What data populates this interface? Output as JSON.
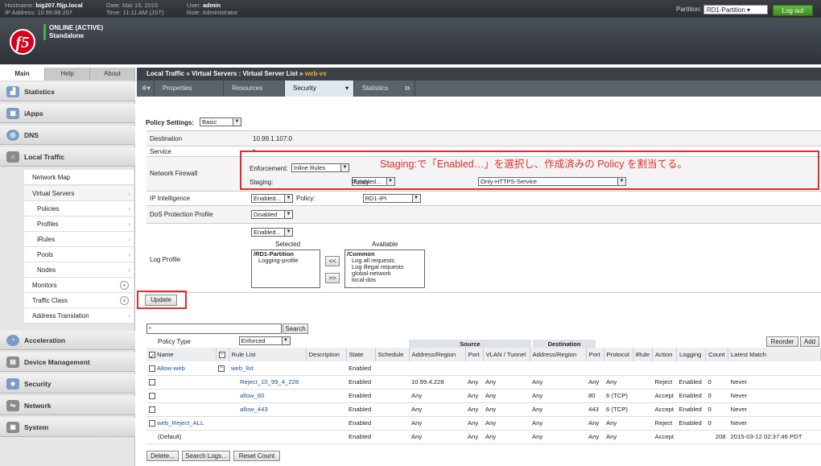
{
  "header": {
    "hostname_label": "Hostname:",
    "hostname": "big207.f5jp.local",
    "ip_label": "IP Address:",
    "ip": "10.99.88.207",
    "date_label": "Date:",
    "date": "Mar 15, 2015",
    "time_label": "Time:",
    "time": "11:11 AM (JST)",
    "user_label": "User:",
    "user": "admin",
    "role_label": "Role:",
    "role": "Administrator",
    "partition_label": "Partition:",
    "partition": "RD1-Partition",
    "logout": "Log out",
    "status1": "ONLINE (ACTIVE)",
    "status2": "Standalone",
    "logo": "f5"
  },
  "sidebar": {
    "tabs": [
      "Main",
      "Help",
      "About"
    ],
    "sections": [
      {
        "label": "Statistics",
        "icon": "chart-icon"
      },
      {
        "label": "iApps",
        "icon": "apps-icon"
      },
      {
        "label": "DNS",
        "icon": "globe-icon"
      },
      {
        "label": "Local Traffic",
        "icon": "local-traffic-icon"
      },
      {
        "label": "Acceleration",
        "icon": "gauge-icon"
      },
      {
        "label": "Device Management",
        "icon": "device-icon"
      },
      {
        "label": "Security",
        "icon": "shield-icon"
      },
      {
        "label": "Network",
        "icon": "network-icon"
      },
      {
        "label": "System",
        "icon": "system-icon"
      }
    ],
    "lt_items": [
      "Network Map",
      "Virtual Servers",
      "Policies",
      "Profiles",
      "iRules",
      "Pools",
      "Nodes",
      "Monitors",
      "Traffic Class",
      "Address Translation"
    ]
  },
  "breadcrumb": {
    "path": "Local Traffic  »  Virtual Servers : Virtual Server List  »  ",
    "current": "web-vs"
  },
  "subtabs": [
    "Properties",
    "Resources",
    "Security",
    "Statistics"
  ],
  "form": {
    "policy_settings_label": "Policy Settings:",
    "policy_settings_value": "Basic",
    "destination_label": "Destination",
    "destination_value": "10.99.1.107:0",
    "service_label": "Service",
    "service_value": "*",
    "firewall_label": "Network Firewall",
    "enforcement_label": "Enforcement:",
    "enforcement_value": "Inline Rules",
    "staging_label": "Staging:",
    "staging_value": "Enabled...",
    "policy_label": "Policy:",
    "policy_value": "Only-HTTPS-Service",
    "ip_intel_label": "IP Intelligence",
    "ip_intel_value": "Enabled...",
    "ip_intel_policy_label": "Policy:",
    "ip_intel_policy_value": "RD1-IPI",
    "dos_label": "DoS Protection Profile",
    "dos_value": "Disabled",
    "log_label": "Log Profile",
    "log_value": "Enabled...",
    "selected_label": "Selected",
    "available_label": "Available",
    "selected_items": [
      "/RD1-Partition",
      "Logging-profile"
    ],
    "available_items": [
      "/Common",
      "Log all requests",
      "Log illegal requests",
      "global-network",
      "local-dos"
    ],
    "move_left": "<<",
    "move_right": ">>",
    "update": "Update"
  },
  "callout": "Staging:で「Enabled…」を選択し、作成済みの Policy を割当てる。",
  "rules": {
    "search_value": "*",
    "search_btn": "Search",
    "policy_type_label": "Policy Type",
    "policy_type_value": "Enforced",
    "reorder": "Reorder",
    "add": "Add",
    "group_source": "Source",
    "group_destination": "Destination",
    "columns": [
      "Name",
      "",
      "Rule List",
      "Description",
      "State",
      "Schedule",
      "Address/Region",
      "Port",
      "VLAN / Tunnel",
      "Address/Region",
      "Port",
      "Protocol",
      "iRule",
      "Action",
      "Logging",
      "Count",
      "Latest Match"
    ],
    "rows": [
      {
        "name": "Allow-web",
        "rl": "web_list",
        "state": "Enabled",
        "sa": "",
        "sp": "",
        "vlan": "",
        "da": "",
        "dp": "",
        "proto": "",
        "action": "",
        "log": "",
        "count": "",
        "latest": ""
      },
      {
        "name": "",
        "rl": "Reject_10_99_4_228",
        "state": "Enabled",
        "sa": "10.99.4.228",
        "sp": "Any",
        "vlan": "Any",
        "da": "Any",
        "dp": "Any",
        "proto": "Any",
        "action": "Reject",
        "log": "Enabled",
        "count": "0",
        "latest": "Never"
      },
      {
        "name": "",
        "rl": "allow_80",
        "state": "Enabled",
        "sa": "Any",
        "sp": "Any",
        "vlan": "Any",
        "da": "Any",
        "dp": "80",
        "proto": "6 (TCP)",
        "action": "Accept",
        "log": "Enabled",
        "count": "0",
        "latest": "Never"
      },
      {
        "name": "",
        "rl": "allow_443",
        "state": "Enabled",
        "sa": "Any",
        "sp": "Any",
        "vlan": "Any",
        "da": "Any",
        "dp": "443",
        "proto": "6 (TCP)",
        "action": "Accept",
        "log": "Enabled",
        "count": "0",
        "latest": "Never"
      },
      {
        "name": "web_Reject_ALL",
        "rl": "",
        "state": "Enabled",
        "sa": "Any",
        "sp": "Any",
        "vlan": "Any",
        "da": "Any",
        "dp": "Any",
        "proto": "Any",
        "action": "Reject",
        "log": "Enabled",
        "count": "0",
        "latest": "Never"
      },
      {
        "name": "(Default)",
        "rl": "",
        "state": "Enabled",
        "sa": "Any",
        "sp": "Any",
        "vlan": "Any",
        "da": "Any",
        "dp": "Any",
        "proto": "Any",
        "action": "Accept",
        "log": "",
        "count": "208",
        "latest": "2015-03-12 02:37:46 PDT"
      }
    ],
    "delete": "Delete...",
    "search_logs": "Search Logs...",
    "reset_count": "Reset Count"
  }
}
